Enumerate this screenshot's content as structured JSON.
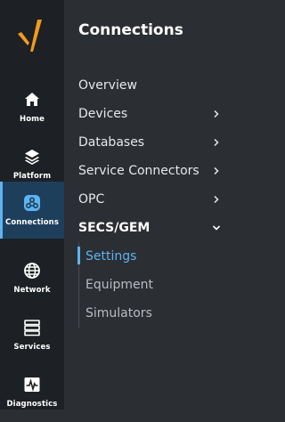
{
  "rail": {
    "items": [
      {
        "label": "Home",
        "icon": "home-icon"
      },
      {
        "label": "Platform",
        "icon": "layers-icon"
      },
      {
        "label": "Connections",
        "icon": "connections-icon",
        "active": true
      },
      {
        "label": "Network",
        "icon": "globe-icon"
      },
      {
        "label": "Services",
        "icon": "server-icon"
      },
      {
        "label": "Diagnostics",
        "icon": "pulse-icon"
      }
    ]
  },
  "panel": {
    "title": "Connections",
    "items": [
      {
        "label": "Overview"
      },
      {
        "label": "Devices",
        "chevron": "right"
      },
      {
        "label": "Databases",
        "chevron": "right"
      },
      {
        "label": "Service Connectors",
        "chevron": "right"
      },
      {
        "label": "OPC",
        "chevron": "right"
      },
      {
        "label": "SECS/GEM",
        "chevron": "down",
        "expanded": true
      }
    ],
    "sub_items": [
      {
        "label": "Settings",
        "active": true
      },
      {
        "label": "Equipment"
      },
      {
        "label": "Simulators"
      }
    ]
  },
  "colors": {
    "rail_bg": "#1d2024",
    "panel_bg": "#2b2e33",
    "accent": "#5fb3f0",
    "logo_orange": "#f39a1f"
  }
}
